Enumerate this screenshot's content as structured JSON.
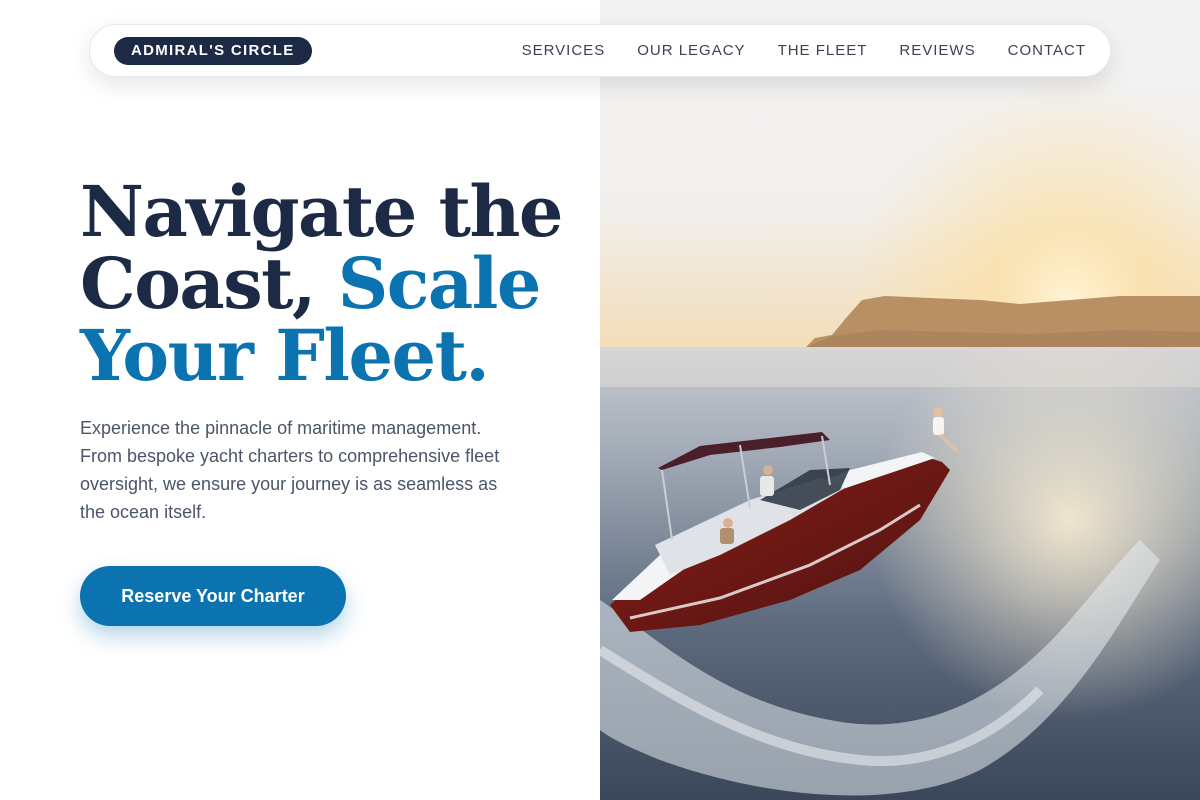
{
  "nav": {
    "brand": "ADMIRAL'S CIRCLE",
    "links": [
      "SERVICES",
      "OUR LEGACY",
      "THE FLEET",
      "REVIEWS",
      "CONTACT"
    ]
  },
  "hero": {
    "headline_line1": "Navigate the",
    "headline_line2a": "Coast, ",
    "headline_line2b": "Scale",
    "headline_line3": "Your Fleet.",
    "lead": "Experience the pinnacle of maritime management. From bespoke yacht charters to comprehensive fleet oversight, we ensure your journey is as seamless as the ocean itself.",
    "cta_label": "Reserve Your Charter"
  },
  "image": {
    "subject": "speedboat-at-sunset"
  },
  "colors": {
    "navy": "#1c2a45",
    "accent_blue": "#0a73b0",
    "body_text": "#4a5568",
    "nav_text": "#3a4354"
  }
}
